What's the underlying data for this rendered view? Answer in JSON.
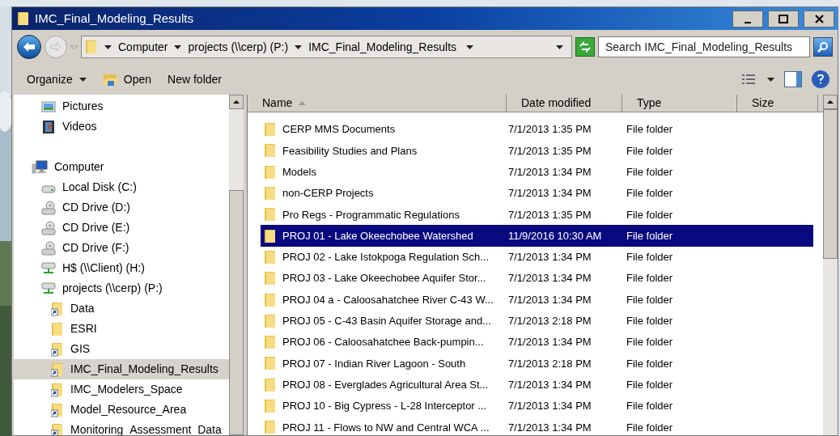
{
  "window": {
    "title": "IMC_Final_Modeling_Results"
  },
  "address_bar": {
    "segments": [
      "Computer",
      "projects (\\\\cerp) (P:)",
      "IMC_Final_Modeling_Results"
    ]
  },
  "search": {
    "placeholder": "Search IMC_Final_Modeling_Results"
  },
  "toolbar": {
    "buttons": [
      {
        "label": "Organize",
        "kind": "menu"
      },
      {
        "label": "Open",
        "kind": "open"
      },
      {
        "label": "New folder",
        "kind": "plain"
      }
    ]
  },
  "sidebar": {
    "items": [
      {
        "label": "Pictures",
        "kind": "pictures",
        "selected": false
      },
      {
        "label": "Videos",
        "kind": "videos",
        "selected": false
      },
      {
        "label": "Computer",
        "kind": "computer",
        "selected": false,
        "children": [
          {
            "label": "Local Disk (C:)",
            "kind": "disk",
            "selected": false
          },
          {
            "label": "CD Drive (D:)",
            "kind": "cd",
            "selected": false
          },
          {
            "label": "CD Drive (E:)",
            "kind": "cd",
            "selected": false
          },
          {
            "label": "CD Drive (F:)",
            "kind": "cd",
            "selected": false
          },
          {
            "label": "H$ (\\\\Client) (H:)",
            "kind": "network",
            "selected": false
          },
          {
            "label": "projects (\\\\cerp) (P:)",
            "kind": "network",
            "selected": false,
            "children": [
              {
                "label": "Data",
                "kind": "shortcut",
                "selected": false
              },
              {
                "label": "ESRI",
                "kind": "folder",
                "selected": false
              },
              {
                "label": "GIS",
                "kind": "shortcut",
                "selected": false
              },
              {
                "label": "IMC_Final_Modeling_Results",
                "kind": "shortcut",
                "selected": true
              },
              {
                "label": "IMC_Modelers_Space",
                "kind": "shortcut",
                "selected": false
              },
              {
                "label": "Model_Resource_Area",
                "kind": "shortcut",
                "selected": false
              },
              {
                "label": "Monitoring_Assessment_Data",
                "kind": "shortcut",
                "selected": false
              }
            ]
          }
        ]
      }
    ]
  },
  "table": {
    "columns": [
      {
        "label": "Name",
        "sorted": true
      },
      {
        "label": "Date modified",
        "sorted": false
      },
      {
        "label": "Type",
        "sorted": false
      },
      {
        "label": "Size",
        "sorted": false
      }
    ],
    "rows": [
      {
        "name": "CERP MMS Documents",
        "date": "7/1/2013 1:35 PM",
        "type": "File folder",
        "selected": false
      },
      {
        "name": "Feasibility Studies and Plans",
        "date": "7/1/2013 1:35 PM",
        "type": "File folder",
        "selected": false
      },
      {
        "name": "Models",
        "date": "7/1/2013 1:34 PM",
        "type": "File folder",
        "selected": false
      },
      {
        "name": "non-CERP Projects",
        "date": "7/1/2013 1:34 PM",
        "type": "File folder",
        "selected": false
      },
      {
        "name": "Pro Regs - Programmatic Regulations",
        "date": "7/1/2013 1:35 PM",
        "type": "File folder",
        "selected": false
      },
      {
        "name": "PROJ 01 - Lake Okeechobee Watershed",
        "date": "11/9/2016 10:30 AM",
        "type": "File folder",
        "selected": true
      },
      {
        "name": "PROJ 02 - Lake Istokpoga Regulation Sch...",
        "date": "7/1/2013 1:34 PM",
        "type": "File folder",
        "selected": false
      },
      {
        "name": "PROJ 03 - Lake Okeechobee Aquifer Stor...",
        "date": "7/1/2013 1:34 PM",
        "type": "File folder",
        "selected": false
      },
      {
        "name": "PROJ 04 a - Caloosahatchee River C-43 W...",
        "date": "7/1/2013 1:34 PM",
        "type": "File folder",
        "selected": false
      },
      {
        "name": "PROJ 05 - C-43 Basin Aquifer Storage and...",
        "date": "7/1/2013 2:18 PM",
        "type": "File folder",
        "selected": false
      },
      {
        "name": "PROJ 06 - Caloosahatchee Back-pumpin...",
        "date": "7/1/2013 1:34 PM",
        "type": "File folder",
        "selected": false
      },
      {
        "name": "PROJ 07 - Indian River Lagoon - South",
        "date": "7/1/2013 2:18 PM",
        "type": "File folder",
        "selected": false
      },
      {
        "name": "PROJ 08 - Everglades Agricultural Area St...",
        "date": "7/1/2013 1:34 PM",
        "type": "File folder",
        "selected": false
      },
      {
        "name": "PROJ 10 - Big Cypress - L-28 Interceptor ...",
        "date": "7/1/2013 1:34 PM",
        "type": "File folder",
        "selected": false
      },
      {
        "name": "PROJ 11 - Flows to NW and Central WCA ...",
        "date": "7/1/2013 1:34 PM",
        "type": "File folder",
        "selected": false
      }
    ]
  }
}
